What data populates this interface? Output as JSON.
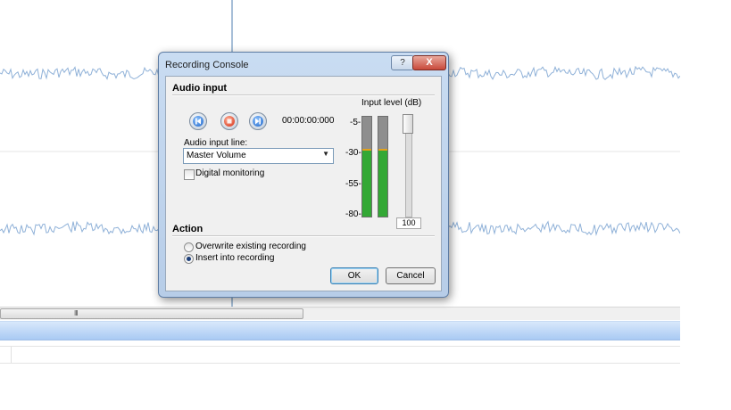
{
  "dialog": {
    "title": "Recording Console",
    "help_label": "?",
    "close_label": "X",
    "audio_input": {
      "heading": "Audio input",
      "time": "00:00:00:000",
      "input_line_label": "Audio input line:",
      "input_line_value": "Master Volume",
      "digital_monitoring_label": "Digital monitoring",
      "digital_monitoring_checked": false
    },
    "meter": {
      "title": "Input level (dB)",
      "ticks": [
        "-5-",
        "-30-",
        "-55-",
        "-80-"
      ],
      "left_level": 0.66,
      "right_level": 0.66,
      "slider_value": "100"
    },
    "action": {
      "heading": "Action",
      "options": [
        "Overwrite existing recording",
        "Insert into recording"
      ],
      "selected_index": 1
    },
    "buttons": {
      "ok": "OK",
      "cancel": "Cancel"
    }
  },
  "editor": {
    "scrollbar_grip": "III"
  },
  "colors": {
    "waveform": "#8fb1d8",
    "meter_green": "#33a835",
    "accent_blue": "#1d63c6",
    "record_red": "#d4280e"
  },
  "icons": [
    "skip-back-icon",
    "record-icon",
    "skip-forward-icon",
    "dropdown-arrow-icon"
  ]
}
